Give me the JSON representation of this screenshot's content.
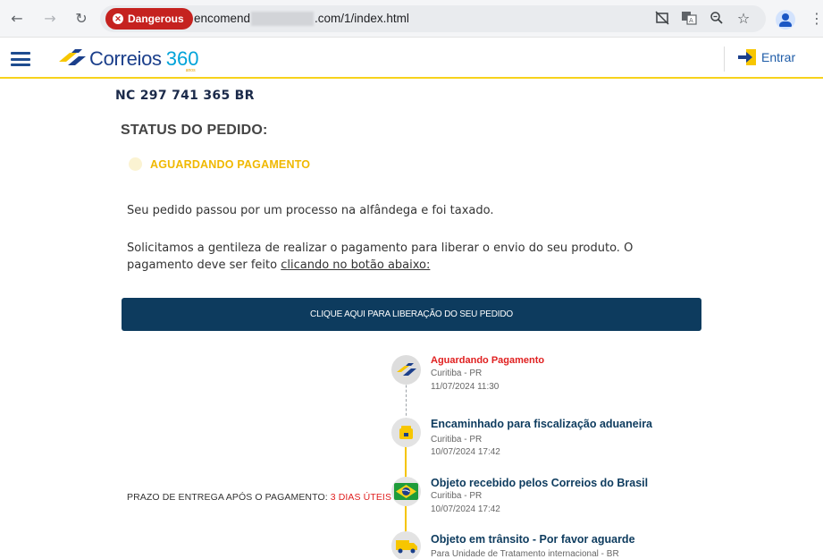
{
  "browser": {
    "security_label": "Dangerous",
    "url_prefix": "encomend",
    "url_suffix": ".com/1/index.html"
  },
  "header": {
    "logo_text": "Correios",
    "logo_number": "360",
    "logo_anos": "anos",
    "login_label": "Entrar"
  },
  "tracking": {
    "code": "NC 297 741 365 BR",
    "status_title": "STATUS DO PEDIDO:",
    "status_value": "AGUARDANDO PAGAMENTO"
  },
  "message": {
    "line1": "Seu pedido passou por um processo na alfândega e foi taxado.",
    "line2_text": "Solicitamos a gentileza de realizar o pagamento para liberar o envio do seu produto. O pagamento deve ser feito ",
    "line2_link": "clicando no botão abaixo:"
  },
  "cta": {
    "label": "CLIQUE AQUI PARA LIBERAÇÃO DO SEU PEDIDO"
  },
  "delivery": {
    "label": "PRAZO DE ENTREGA APÓS O PAGAMENTO: ",
    "value": "3 DIAS ÚTEIS"
  },
  "timeline": [
    {
      "title": "Aguardando Pagamento",
      "location": "Curitiba - PR",
      "datetime": "11/07/2024 11:30",
      "icon": "correios-logo-icon"
    },
    {
      "title": "Encaminhado para fiscalização aduaneira",
      "location": "Curitiba - PR",
      "datetime": "10/07/2024 17:42",
      "icon": "customs-box-icon"
    },
    {
      "title": "Objeto recebido pelos Correios do Brasil",
      "location": "Curitiba - PR",
      "datetime": "10/07/2024 17:42",
      "icon": "brazil-flag-icon"
    },
    {
      "title": "Objeto em trânsito - Por favor aguarde",
      "location": "Para Unidade de Tratamento internacional - BR",
      "icon": "delivery-truck-icon"
    }
  ],
  "colors": {
    "brand_blue": "#1b3f8b",
    "cta_bg": "#0d3b5e",
    "status_yellow": "#f0b800",
    "alert_red": "#e02020",
    "header_border": "#f7d21c"
  }
}
